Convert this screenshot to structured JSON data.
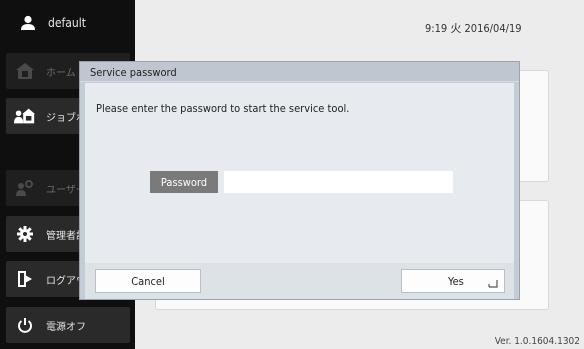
{
  "sidebar": {
    "user": {
      "name": "default",
      "icon": "user-icon"
    },
    "items": [
      {
        "label": "ホーム",
        "icon": "home-icon",
        "disabled": true
      },
      {
        "label": "ジョブボ",
        "icon": "job-box-icon",
        "disabled": false
      },
      {
        "label": "ユーザー",
        "icon": "user-settings-icon",
        "disabled": true
      },
      {
        "label": "管理者設",
        "icon": "gear-icon",
        "disabled": false
      },
      {
        "label": "ログアウ",
        "icon": "logout-icon",
        "disabled": false
      },
      {
        "label": "電源オフ",
        "icon": "power-icon",
        "disabled": false
      }
    ]
  },
  "status": {
    "datetime": "9:19 火 2016/04/19",
    "version": "Ver. 1.0.1604.1302"
  },
  "dialog": {
    "title": "Service password",
    "message": "Please enter the password to start the service tool.",
    "password_label": "Password",
    "password_value": "",
    "cancel_label": "Cancel",
    "yes_label": "Yes"
  },
  "colors": {
    "sidebar_bg": "#0f0f0f",
    "dialog_frame": "#c4ccd6",
    "dialog_body": "#e7ebef",
    "password_label_bg": "#7a7a7a"
  }
}
